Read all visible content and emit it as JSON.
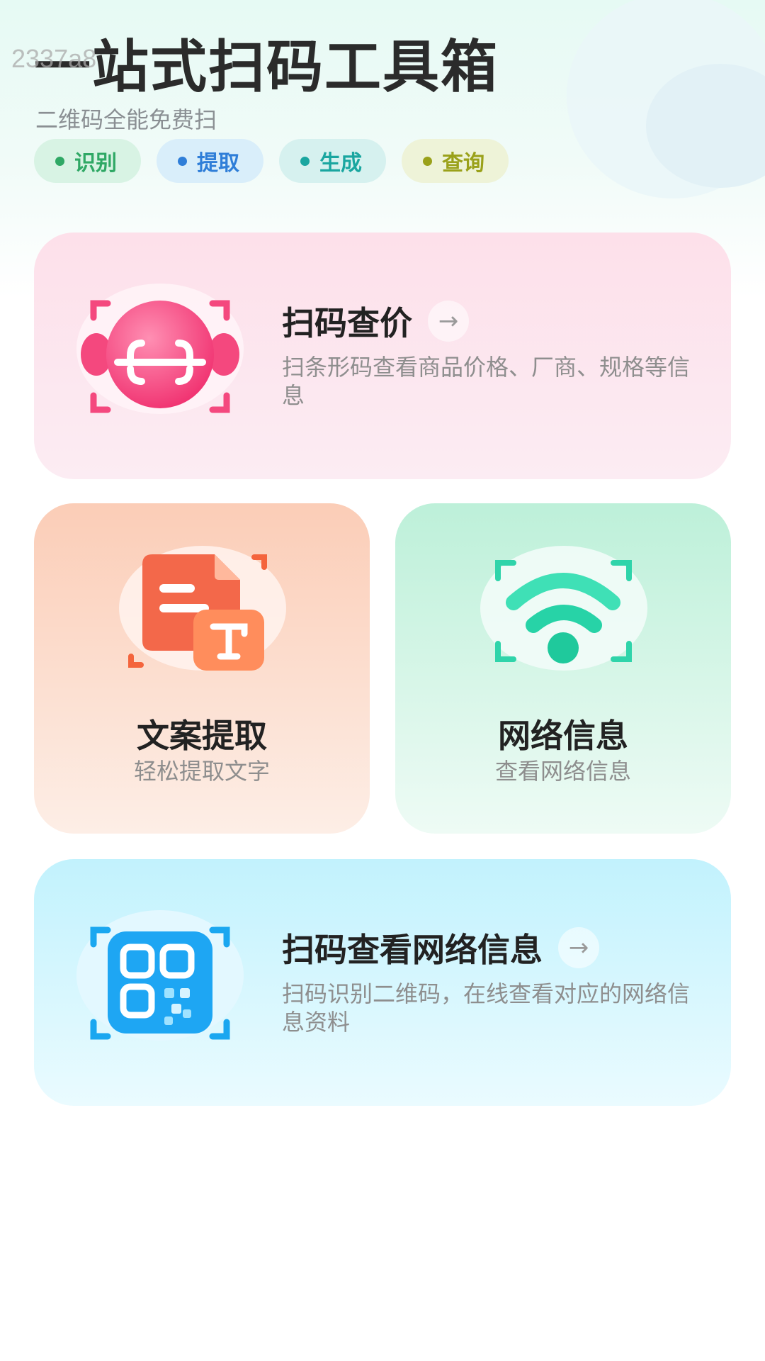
{
  "watermark": "2337a8",
  "header": {
    "title": "一站式扫码工具箱",
    "subtitle": "二维码全能免费扫",
    "tags": [
      {
        "label": "识别",
        "color": "#2fa865",
        "bg": "#d8f3e4"
      },
      {
        "label": "提取",
        "color": "#2f7ed8",
        "bg": "#d9eefa"
      },
      {
        "label": "生成",
        "color": "#1aa6a0",
        "bg": "#d6f1ef"
      },
      {
        "label": "查询",
        "color": "#9aa11a",
        "bg": "#eef3d8"
      }
    ]
  },
  "cards": {
    "price_scan": {
      "title": "扫码查价",
      "description": "扫条形码查看商品价格、厂商、规格等信息",
      "icon": "scan-face-icon",
      "accent": "#f5487f"
    },
    "text_extract": {
      "title": "文案提取",
      "description": "轻松提取文字",
      "icon": "text-document-icon",
      "accent": "#f4643c"
    },
    "network_info": {
      "title": "网络信息",
      "description": "查看网络信息",
      "icon": "wifi-icon",
      "accent": "#23d3a8"
    },
    "qr_network": {
      "title": "扫码查看网络信息",
      "description": "扫码识别二维码，在线查看对应的网络信息资料",
      "icon": "qr-code-icon",
      "accent": "#1aa7f0"
    }
  },
  "arrow_icon": "arrow-right-icon"
}
